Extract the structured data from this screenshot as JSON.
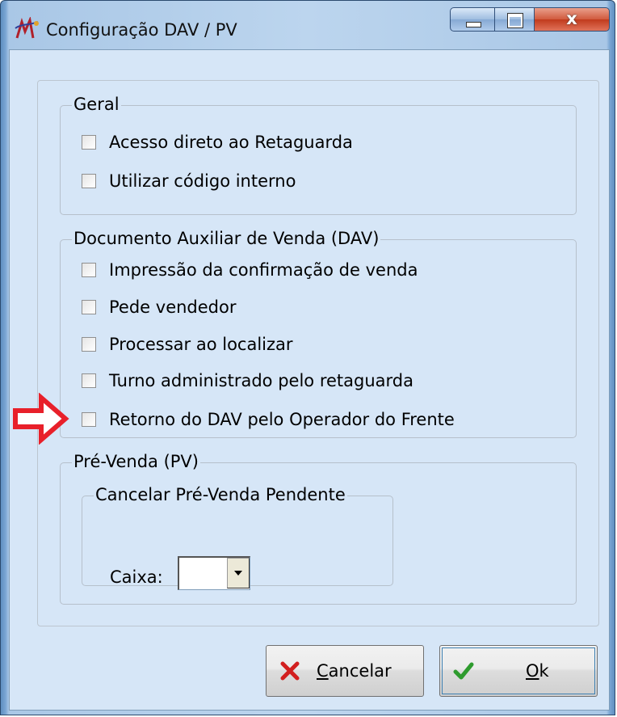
{
  "window": {
    "title": "Configuração DAV / PV",
    "caption": {
      "minimize": "–",
      "maximize": "□",
      "close": "x"
    }
  },
  "groups": {
    "geral": {
      "legend": "Geral",
      "items": [
        {
          "label": "Acesso direto ao Retaguarda",
          "checked": false
        },
        {
          "label": "Utilizar código interno",
          "checked": false
        }
      ]
    },
    "dav": {
      "legend": "Documento Auxiliar de Venda (DAV)",
      "items": [
        {
          "label": "Impressão da confirmação de venda",
          "checked": false
        },
        {
          "label": "Pede vendedor",
          "checked": false
        },
        {
          "label": "Processar ao localizar",
          "checked": false
        },
        {
          "label": "Turno administrado pelo retaguarda",
          "checked": false
        },
        {
          "label": "Retorno do DAV pelo Operador do Frente",
          "checked": false
        }
      ]
    },
    "pv": {
      "legend": "Pré-Venda (PV)",
      "sub": {
        "legend": "Cancelar Pré-Venda Pendente",
        "caixa_label": "Caixa:",
        "caixa_value": ""
      }
    }
  },
  "buttons": {
    "cancel": {
      "mnemonic": "C",
      "rest": "ancelar"
    },
    "ok": {
      "mnemonic": "O",
      "rest": "k"
    }
  },
  "colors": {
    "client_bg": "#d6e6f7",
    "arrow": "#e8202a",
    "cancel_icon": "#d21f1f",
    "ok_icon": "#2e9b2e"
  },
  "icons": {
    "app": "app-logo-icon",
    "cancel": "x-cross-icon",
    "ok": "checkmark-icon",
    "pointer": "red-arrow-icon"
  }
}
